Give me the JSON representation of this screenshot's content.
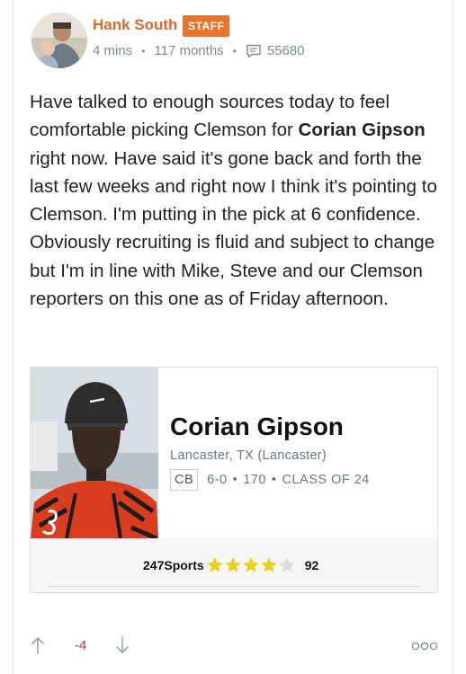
{
  "post": {
    "author": "Hank South",
    "badge": "STAFF",
    "time_ago": "4 mins",
    "member_age": "117 months",
    "message_count": "55680",
    "body": {
      "p1": "Have talked to enough sources today to feel comfortable picking Clemson for ",
      "bold_name": "Corian Gipson",
      "p2": " right now. Have said it's gone back and forth the last few weeks and right now I think it's pointing to Clemson. I'm putting in the pick at 6 confidence. Obviously recruiting is fluid and subject to change but I'm in line with Mike, Steve and our Clemson reporters on this one as of Friday afternoon."
    }
  },
  "player": {
    "name": "Corian Gipson",
    "location": "Lancaster, TX (Lancaster)",
    "position": "CB",
    "height": "6-0",
    "weight": "170",
    "class": "CLASS OF 24",
    "rating_source": "247Sports",
    "stars": 4,
    "max_stars": 5,
    "score": "92"
  },
  "footer": {
    "vote_count": "-4"
  },
  "colors": {
    "accent": "#d8692a",
    "badge": "#e9742b",
    "star_on": "#e8d21e",
    "star_off": "#dcdcdc",
    "negative": "#c7302f"
  },
  "icons": [
    "message-icon",
    "star-icon",
    "upvote-arrow-icon",
    "downvote-arrow-icon",
    "more-options-icon"
  ]
}
